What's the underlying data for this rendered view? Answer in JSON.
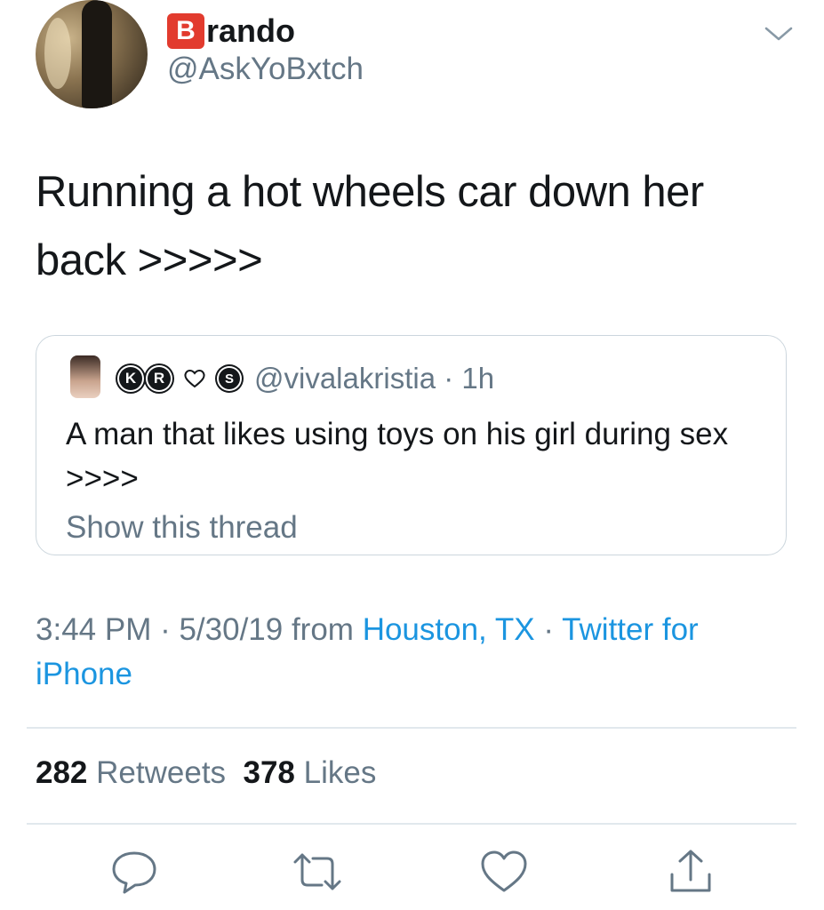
{
  "author": {
    "badge_letter": "B",
    "display_name_rest": "rando",
    "handle": "@AskYoBxtch",
    "badge_color": "#e23b2e"
  },
  "tweet": {
    "text": "Running a hot wheels car down her back >>>>>"
  },
  "quoted_tweet": {
    "badges": [
      "K",
      "R"
    ],
    "badge2": "S",
    "handle_time": "@vivalakristia · 1h",
    "text": "A man that likes using toys on his girl during sex >>>>",
    "show_thread": "Show this thread"
  },
  "meta": {
    "time_date": "3:44 PM · 5/30/19 from",
    "location": "Houston, TX",
    "separator": "·",
    "client": "Twitter for iPhone",
    "link_color": "#1b95e0"
  },
  "stats": {
    "retweets_count": "282",
    "retweets_label": "Retweets",
    "likes_count": "378",
    "likes_label": "Likes"
  },
  "actions": [
    "reply-icon",
    "retweet-icon",
    "like-icon",
    "share-icon"
  ]
}
